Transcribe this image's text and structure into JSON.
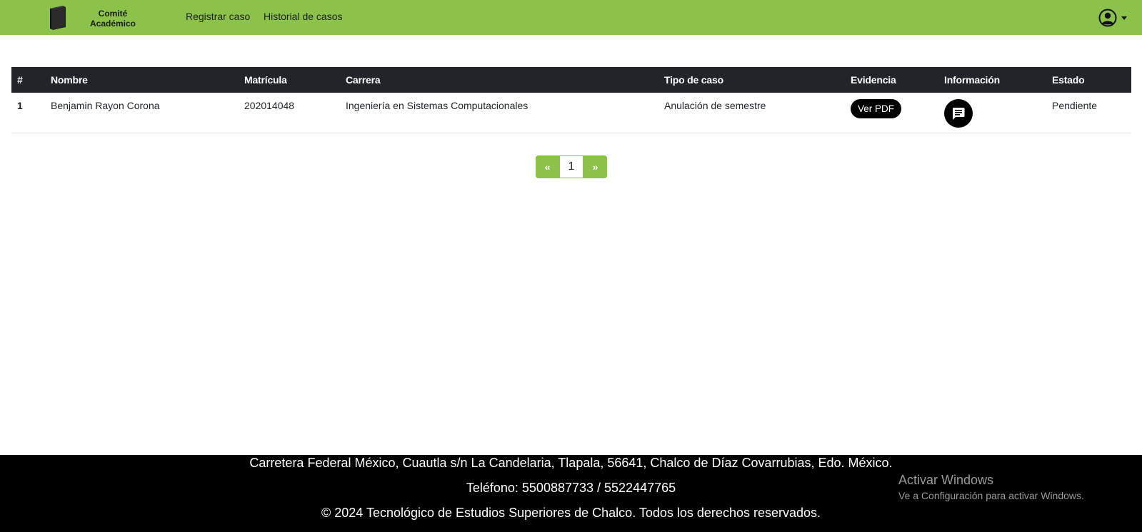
{
  "navbar": {
    "brand_text": "Comité Académico",
    "links": [
      "Registrar caso",
      "Historial de casos"
    ],
    "bg_color": "#8bc34a",
    "user_icon": "user-circle-icon"
  },
  "table": {
    "headers": [
      "#",
      "Nombre",
      "Matrícula",
      "Carrera",
      "Tipo de caso",
      "Evidencia",
      "Información",
      "Estado"
    ],
    "rows": [
      {
        "num": "1",
        "nombre": "Benjamin Rayon Corona",
        "matricula": "202014048",
        "carrera": "Ingeniería en Sistemas Computacionales",
        "tipo": "Anulación de semestre",
        "evidencia_label": "Ver PDF",
        "info_icon": "message-icon",
        "estado": "Pendiente"
      }
    ]
  },
  "pagination": {
    "prev": "«",
    "current": "1",
    "next": "»"
  },
  "footer": {
    "address": "Carretera Federal México, Cuautla s/n La Candelaria, Tlapala, 56641, Chalco de Díaz Covarrubias, Edo. México.",
    "phone": "Teléfono: 5500887733 / 5522447765",
    "copyright": "© 2024 Tecnológico de Estudios Superiores de Chalco. Todos los derechos reservados."
  },
  "watermark": {
    "title": "Activar Windows",
    "subtitle": "Ve a Configuración para activar Windows."
  }
}
